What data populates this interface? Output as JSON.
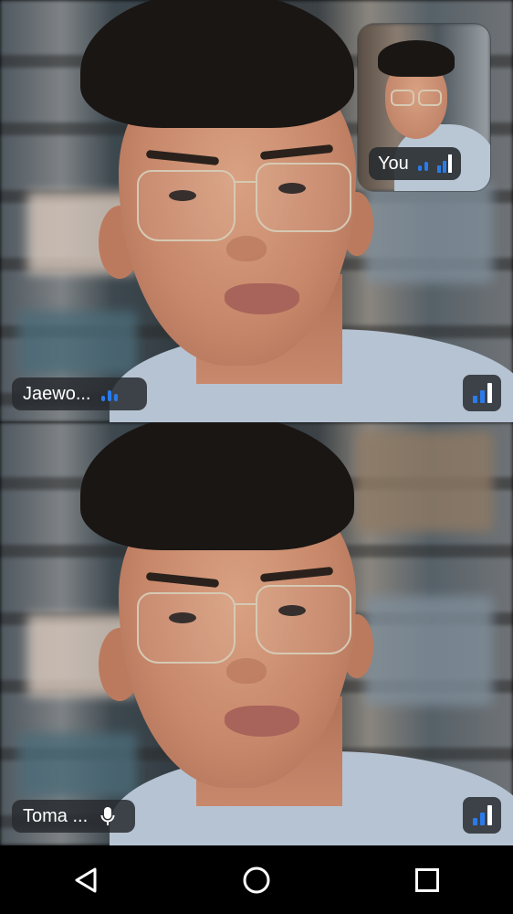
{
  "participants": [
    {
      "name": "Jaewo...",
      "status_icon": "audio-activity-icon"
    },
    {
      "name": "Toma ...",
      "status_icon": "microphone-icon"
    }
  ],
  "self_view": {
    "label": "You"
  },
  "colors": {
    "accent": "#2a7bea",
    "pill_bg": "#2c3034",
    "nav_icon": "#ffffff"
  },
  "nav": {
    "icons": [
      "back-icon",
      "home-icon",
      "recents-icon"
    ]
  }
}
